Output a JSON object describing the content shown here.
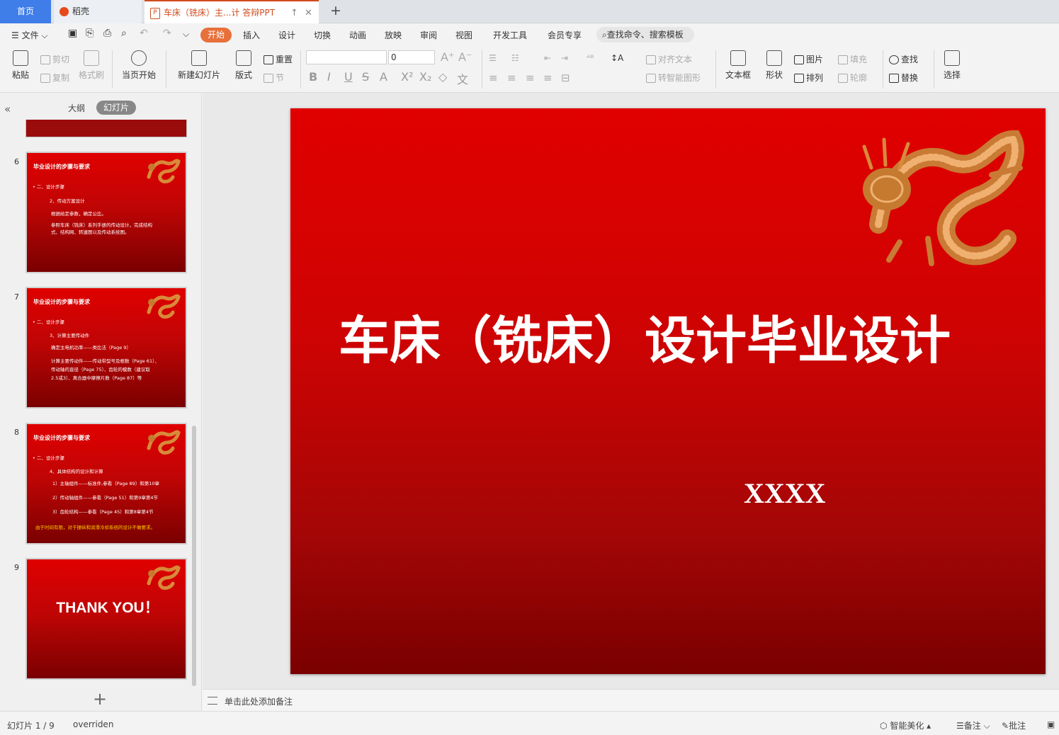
{
  "tabs": {
    "home": "首页",
    "daoke": "稻壳",
    "document": "车床（铣床）主...计 答辩PPT"
  },
  "menu": {
    "file": "文件",
    "items": [
      "开始",
      "插入",
      "设计",
      "切换",
      "动画",
      "放映",
      "审阅",
      "视图",
      "开发工具",
      "会员专享"
    ],
    "search": "查找命令、搜索模板"
  },
  "ribbon": {
    "paste": "粘贴",
    "cut": "剪切",
    "copy": "复制",
    "format_painter": "格式刷",
    "from_current": "当页开始",
    "new_slide": "新建幻灯片",
    "layout": "版式",
    "reset": "重置",
    "section": "节",
    "font_size": "0",
    "align_text": "对齐文本",
    "smart_shape": "转智能图形",
    "textbox": "文本框",
    "shape": "形状",
    "picture": "图片",
    "fill": "填充",
    "arrange": "排列",
    "outline": "轮廓",
    "find": "查找",
    "replace": "替换",
    "select": "选择"
  },
  "panel": {
    "outline_tab": "大纲",
    "slides_tab": "幻灯片"
  },
  "thumbnails": [
    {
      "num": "6",
      "title": "毕业设计的步骤与要求",
      "lines": [
        "•  二、设计步骤",
        "2、传动方案设计",
        "根据给定参数，确定公比。",
        "参照车床（铣床）系列手册的传动设计，完成结构",
        "式、结构网、转速图以及传动系统图。"
      ]
    },
    {
      "num": "7",
      "title": "毕业设计的步骤与要求",
      "lines": [
        "•  二、设计步骤",
        "3、计算主要传动件",
        "确定主电机功率——类比法（Page 9）",
        "计算主要传动件——传动带型号及根数（Page 61）、",
        "传动轴的直径（Page 75）、齿轮的模数（建议取",
        "2.5或3）、离合器中摩擦片数（Page 87）等"
      ]
    },
    {
      "num": "8",
      "title": "毕业设计的步骤与要求",
      "lines": [
        "•  二、设计步骤",
        "4、具体结构的设计和计算",
        "1）主轴组件——标准件,参看（Page 89）和第10章",
        "2）传动轴组件——参看（Page 51）和第9章第4节",
        "3）齿轮结构——参看（Page 45）和第8章第4节"
      ],
      "note": "由于时间有限，对于操纵和润滑冷却系统的设计不做要求。"
    },
    {
      "num": "9",
      "thank_you": "THANK YOU！"
    }
  ],
  "slide": {
    "title": "车床（铣床）设计毕业设计",
    "author": "XXXX"
  },
  "notes_placeholder": "单击此处添加备注",
  "status": {
    "slide_count": "幻灯片 1 / 9",
    "overridden": "overriden",
    "beautify": "智能美化",
    "notes": "备注",
    "comment": "批注"
  },
  "colors": {
    "accent": "#e7703b",
    "slide_red": "#d90000",
    "slide_dark": "#7a0000",
    "home_tab": "#3f7de8"
  }
}
